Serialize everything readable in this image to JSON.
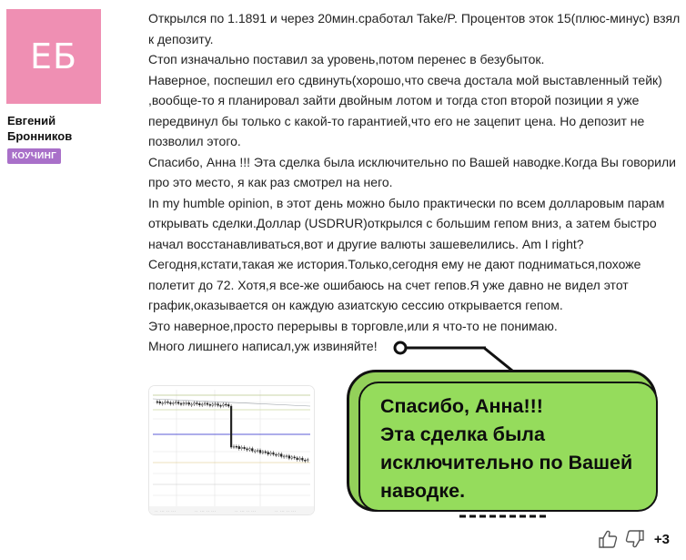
{
  "author": {
    "initials": "ЕБ",
    "name": "Евгений Бронников",
    "badge": "КОУЧИНГ",
    "avatar_color": "#ef8fb3",
    "badge_color": "#a970c9"
  },
  "post": {
    "paragraphs": [
      "Открылся по 1.1891 и через 20мин.сработал Take/P. Процентов эток 15(плюс-минус) взял к депозиту.",
      "Стоп изначально поставил за уровень,потом перенес в безубыток.",
      "Наверное, поспешил его сдвинуть(хорошо,что свеча достала мой выставленный тейк) ,вообще-то я планировал зайти двойным лотом и тогда стоп второй позиции я уже передвинул бы только с какой-то гарантией,что его не зацепит цена. Но депозит не позволил этого.",
      "Спасибо, Анна !!! Эта сделка была исключительно по Вашей наводке.Когда Вы говорили про это место, я как раз смотрел на него.",
      "In my humble opinion, в этот день можно было практически по всем долларовым парам открывать сделки.Доллар (USDRUR)открылся с большим гепом вниз, а затем быстро начал восстанавливаться,вот и другие валюты зашевелились. Am I right?",
      "Сегодня,кстати,такая же история.Только,сегодня ему не дают подниматься,похоже полетит до 72. Хотя,я все-же ошибаюсь на счет гепов.Я уже давно не видел этот график,оказывается он каждую азиатскую сессию открывается гепом.",
      "Это наверное,просто перерывы в торговле,или я что-то не понимаю.",
      "Много лишнего написал,уж извиняйте!"
    ]
  },
  "callout": {
    "lines": [
      "Спасибо, Анна!!!",
      "Эта сделка была",
      "исключительно по Вашей",
      "наводке."
    ],
    "fill_color": "#95dc5c"
  },
  "votes": {
    "like_icon": "thumbs-up-icon",
    "dislike_icon": "thumbs-down-icon",
    "score": "+3"
  }
}
